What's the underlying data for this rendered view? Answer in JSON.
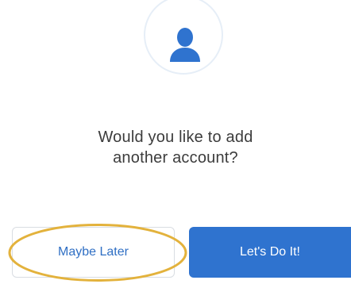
{
  "icons": {
    "avatar": "person-icon"
  },
  "prompt": {
    "line1": "Would you like to add",
    "line2": "another account?"
  },
  "buttons": {
    "secondary_label": "Maybe Later",
    "primary_label": "Let's Do It!"
  },
  "colors": {
    "accent": "#2f73cf",
    "avatar_icon": "#2f73cf",
    "highlight_ring": "#e3b23c"
  }
}
